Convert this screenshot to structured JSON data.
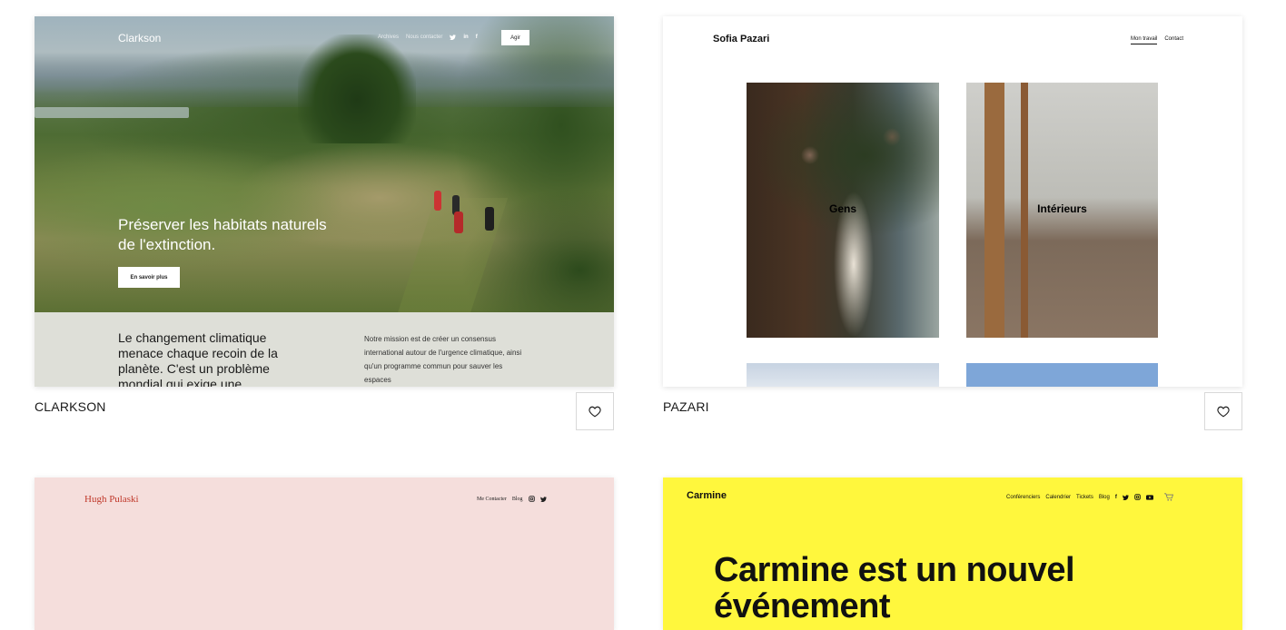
{
  "templates": [
    {
      "name": "CLARKSON",
      "preview": {
        "brand": "Clarkson",
        "nav": [
          "Archives",
          "Nous contacter"
        ],
        "cta_top": "Agir",
        "headline": "Préserver les habitats naturels de l'extinction.",
        "cta": "En savoir plus",
        "lower_title": "Le changement climatique menace chaque recoin de la planète. C'est un problème mondial qui exige une",
        "lower_text": "Notre mission est de créer un consensus international autour de l'urgence climatique, ainsi qu'un programme commun pour sauver les espaces"
      }
    },
    {
      "name": "PAZARI",
      "preview": {
        "brand": "Sofia Pazari",
        "nav": [
          "Mon travail",
          "Contact"
        ],
        "tiles": [
          "Gens",
          "Intérieurs"
        ]
      }
    },
    {
      "name": "",
      "preview": {
        "brand": "Hugh Pulaski",
        "nav": [
          "Me Contacter",
          "Blog"
        ]
      }
    },
    {
      "name": "",
      "preview": {
        "brand": "Carmine",
        "nav": [
          "Conférenciers",
          "Calendrier",
          "Tickets",
          "Blog"
        ],
        "headline": "Carmine est un nouvel événement"
      }
    }
  ],
  "colors": {
    "clarkson_lower_bg": "#dedfd8",
    "pazari_bg": "#ffffff",
    "hugh_bg": "#f5dedc",
    "hugh_brand": "#c0392b",
    "carmine_bg": "#fff73d"
  },
  "icons": {
    "favorite": "heart-icon",
    "social": [
      "twitter-icon",
      "linkedin-icon",
      "facebook-icon",
      "instagram-icon",
      "youtube-icon",
      "cart-icon"
    ]
  }
}
